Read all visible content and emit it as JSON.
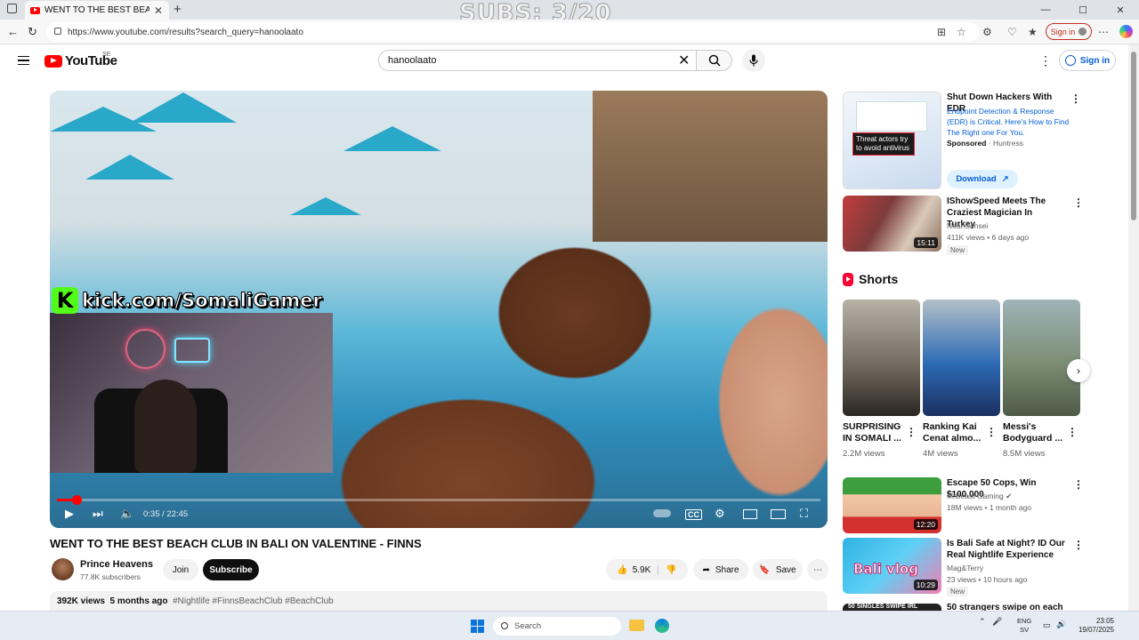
{
  "browser": {
    "tab_title": "WENT TO THE BEST BEACH CLUB",
    "tab_close": "✕",
    "new_tab": "+",
    "url": "https://www.youtube.com/results?search_query=hanoolaato",
    "signin": "Sign in",
    "window_buttons": [
      "—",
      "☐",
      "✕"
    ]
  },
  "overlay": {
    "subs": "SUBS: 3/20",
    "kick_letter": "K",
    "kick_url": "kick.com/SomaliGamer"
  },
  "header": {
    "logo_text": "YouTube",
    "country": "SE",
    "search_value": "hanoolaato",
    "signin": "Sign in"
  },
  "player": {
    "time": "0:35 / 22:45",
    "progress": 0.026
  },
  "video": {
    "title": "WENT TO THE BEST BEACH CLUB IN BALI ON VALENTINE - FINNS",
    "channel": "Prince Heavens",
    "subscribers": "77.8K subscribers",
    "join": "Join",
    "subscribe": "Subscribe",
    "likes": "5.9K",
    "share": "Share",
    "save": "Save",
    "views": "392K views",
    "age": "5 months ago",
    "tags": "#Nightlife #FinnsBeachClub #BeachClub"
  },
  "sidebar": {
    "ad": {
      "title": "Shut Down Hackers With EDR",
      "desc": "Endpoint Detection & Response (EDR) is Critical. Here's How to Find The Right one For You.",
      "sponsored": "Sponsored",
      "advertiser": "Huntress",
      "callout": "Threat actors try to avoid antivirus",
      "cta": "Download"
    },
    "videos": [
      {
        "title": "IShowSpeed Meets The Craziest Magician In Turkey",
        "channel": "NoahSensei",
        "meta": "411K views • 6 days ago",
        "duration": "15:11",
        "badge": "New"
      },
      {
        "title": "Escape 50 Cops, Win $100,000",
        "channel": "MrBeast Gaming",
        "meta": "18M views • 1 month ago",
        "duration": "12:20",
        "badge": ""
      },
      {
        "title": "Is Bali Safe at Night? ID Our Real Nightlife Experience",
        "channel": "Mag&Terry",
        "meta": "23 views • 10 hours ago",
        "duration": "10:29",
        "badge": "New",
        "thumb_text": "Bali vlog"
      },
      {
        "title": "50 strangers swipe on each",
        "channel": "",
        "meta": "",
        "duration": "",
        "badge": "",
        "thumb_text": "50 SINGLES SWIPE IRL"
      }
    ],
    "shorts_label": "Shorts",
    "shorts": [
      {
        "title": "SURPRISING IN SOMALI ...",
        "views": "2.2M views"
      },
      {
        "title": "Ranking Kai Cenat almo...",
        "views": "4M views"
      },
      {
        "title": "Messi's Bodyguard ...",
        "views": "8.5M views"
      }
    ]
  },
  "taskbar": {
    "search": "Search",
    "lang_top": "ENG",
    "lang_bottom": "SV",
    "time": "23:05",
    "date": "19/07/2025"
  }
}
